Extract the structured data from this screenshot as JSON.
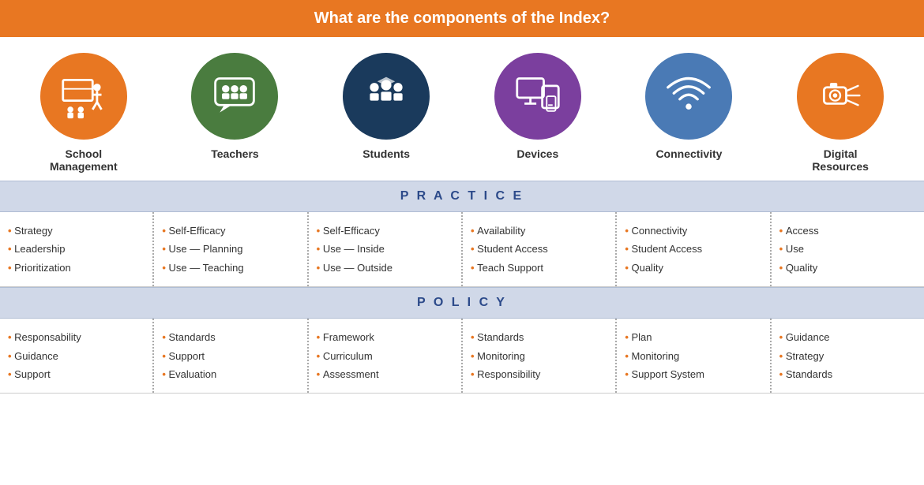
{
  "header": {
    "title": "What are the components of the Index?"
  },
  "icons": [
    {
      "id": "school-management",
      "label": "School\nManagement",
      "color": "#E87722",
      "icon": "school"
    },
    {
      "id": "teachers",
      "label": "Teachers",
      "color": "#4a7c3f",
      "icon": "teachers"
    },
    {
      "id": "students",
      "label": "Students",
      "color": "#1a3a5c",
      "icon": "students"
    },
    {
      "id": "devices",
      "label": "Devices",
      "color": "#7b3f9e",
      "icon": "devices"
    },
    {
      "id": "connectivity",
      "label": "Connectivity",
      "color": "#4a7ab5",
      "icon": "wifi"
    },
    {
      "id": "digital-resources",
      "label": "Digital\nResources",
      "color": "#E87722",
      "icon": "digital"
    }
  ],
  "practice": {
    "section_label": "P R A C T I C E",
    "columns": [
      {
        "items": [
          "Strategy",
          "Leadership",
          "Prioritization"
        ]
      },
      {
        "items": [
          "Self-Efficacy",
          "Use — Planning",
          "Use — Teaching"
        ]
      },
      {
        "items": [
          "Self-Efficacy",
          "Use — Inside",
          "Use — Outside"
        ]
      },
      {
        "items": [
          "Availability",
          "Student Access",
          "Teach Support"
        ]
      },
      {
        "items": [
          "Connectivity",
          "Student Access",
          "Quality"
        ]
      },
      {
        "items": [
          "Access",
          "Use",
          "Quality"
        ]
      }
    ]
  },
  "policy": {
    "section_label": "P O L I C Y",
    "columns": [
      {
        "items": [
          "Responsability",
          "Guidance",
          "Support"
        ]
      },
      {
        "items": [
          "Standards",
          "Support",
          "Evaluation"
        ]
      },
      {
        "items": [
          "Framework",
          "Curriculum",
          "Assessment"
        ]
      },
      {
        "items": [
          "Standards",
          "Monitoring",
          "Responsibility"
        ]
      },
      {
        "items": [
          "Plan",
          "Monitoring",
          "Support System"
        ]
      },
      {
        "items": [
          "Guidance",
          "Strategy",
          "Standards"
        ]
      }
    ]
  }
}
